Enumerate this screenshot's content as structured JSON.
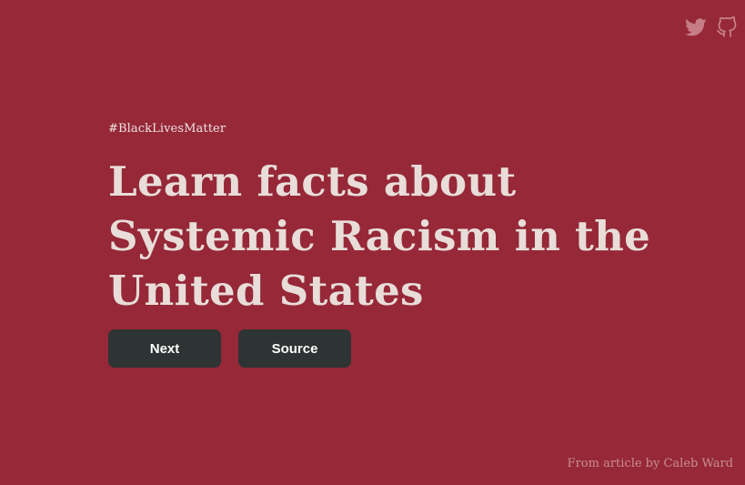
{
  "header": {
    "icons": [
      "twitter-icon",
      "github-icon"
    ],
    "icon_color": "#c77d86"
  },
  "hero": {
    "hashtag": "#BlackLivesMatter",
    "headline": "Learn facts about Systemic Racism in the United States"
  },
  "actions": {
    "next_label": "Next",
    "source_label": "Source"
  },
  "footer": {
    "attribution": "From article by Caleb Ward"
  },
  "colors": {
    "background": "#962838",
    "button": "#2e3433",
    "headline": "#e8ddd8"
  }
}
